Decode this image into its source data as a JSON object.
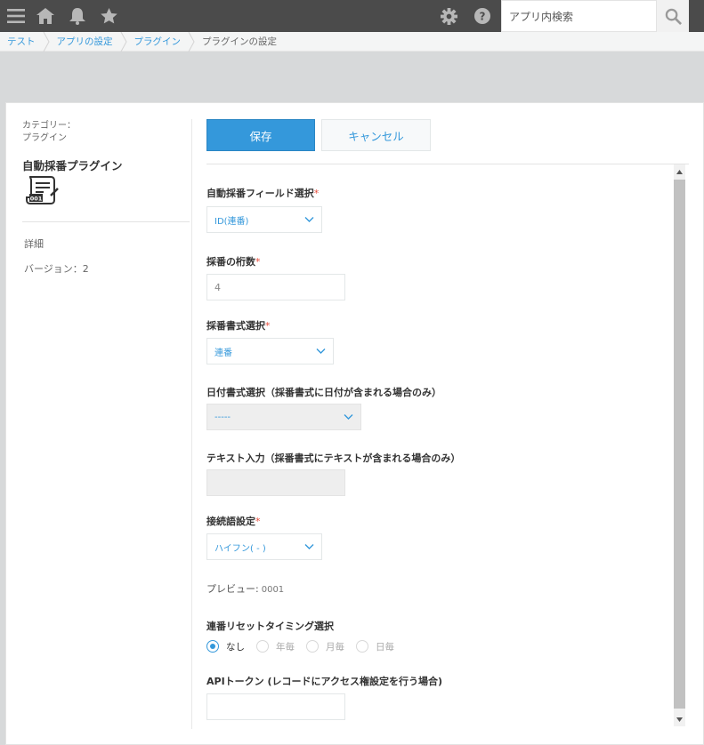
{
  "header": {
    "search": {
      "placeholder": "アプリ内検索"
    }
  },
  "breadcrumb": [
    "テスト",
    "アプリの設定",
    "プラグイン",
    "プラグインの設定"
  ],
  "sidebar": {
    "category_label": "カテゴリー：",
    "category_value": "プラグイン",
    "plugin_name": "自動採番プラグイン",
    "detail_link": "詳細",
    "version": "バージョン：2"
  },
  "actions": {
    "save": "保存",
    "cancel": "キャンセル"
  },
  "form": {
    "field_select": {
      "label": "自動採番フィールド選択",
      "required": "*",
      "value": "ID(連番)"
    },
    "digits": {
      "label": "採番の桁数",
      "required": "*",
      "value": "4"
    },
    "format_select": {
      "label": "採番書式選択",
      "required": "*",
      "value": "連番"
    },
    "date_format": {
      "label": "日付書式選択（採番書式に日付が含まれる場合のみ）",
      "value": "-----"
    },
    "text_input": {
      "label": "テキスト入力（採番書式にテキストが含まれる場合のみ）",
      "value": ""
    },
    "connector": {
      "label": "接続語設定",
      "required": "*",
      "value": "ハイフン( - )"
    },
    "preview": {
      "label": "プレビュー:",
      "value": "0001"
    },
    "reset_timing": {
      "label": "連番リセットタイミング選択",
      "options": [
        "なし",
        "年毎",
        "月毎",
        "日毎"
      ],
      "selected": "なし"
    },
    "api_token": {
      "label": "APIトークン (レコードにアクセス権設定を行う場合)",
      "value": ""
    }
  },
  "colors": {
    "header_bg": "#4b4b4b",
    "accent": "#3498db",
    "required": "#e74c3c",
    "page_bg": "#d7d9da"
  },
  "icons": [
    "menu-icon",
    "home-icon",
    "bell-icon",
    "star-icon",
    "gear-icon",
    "help-icon",
    "search-icon",
    "plugin-icon",
    "chevron-down-icon"
  ]
}
